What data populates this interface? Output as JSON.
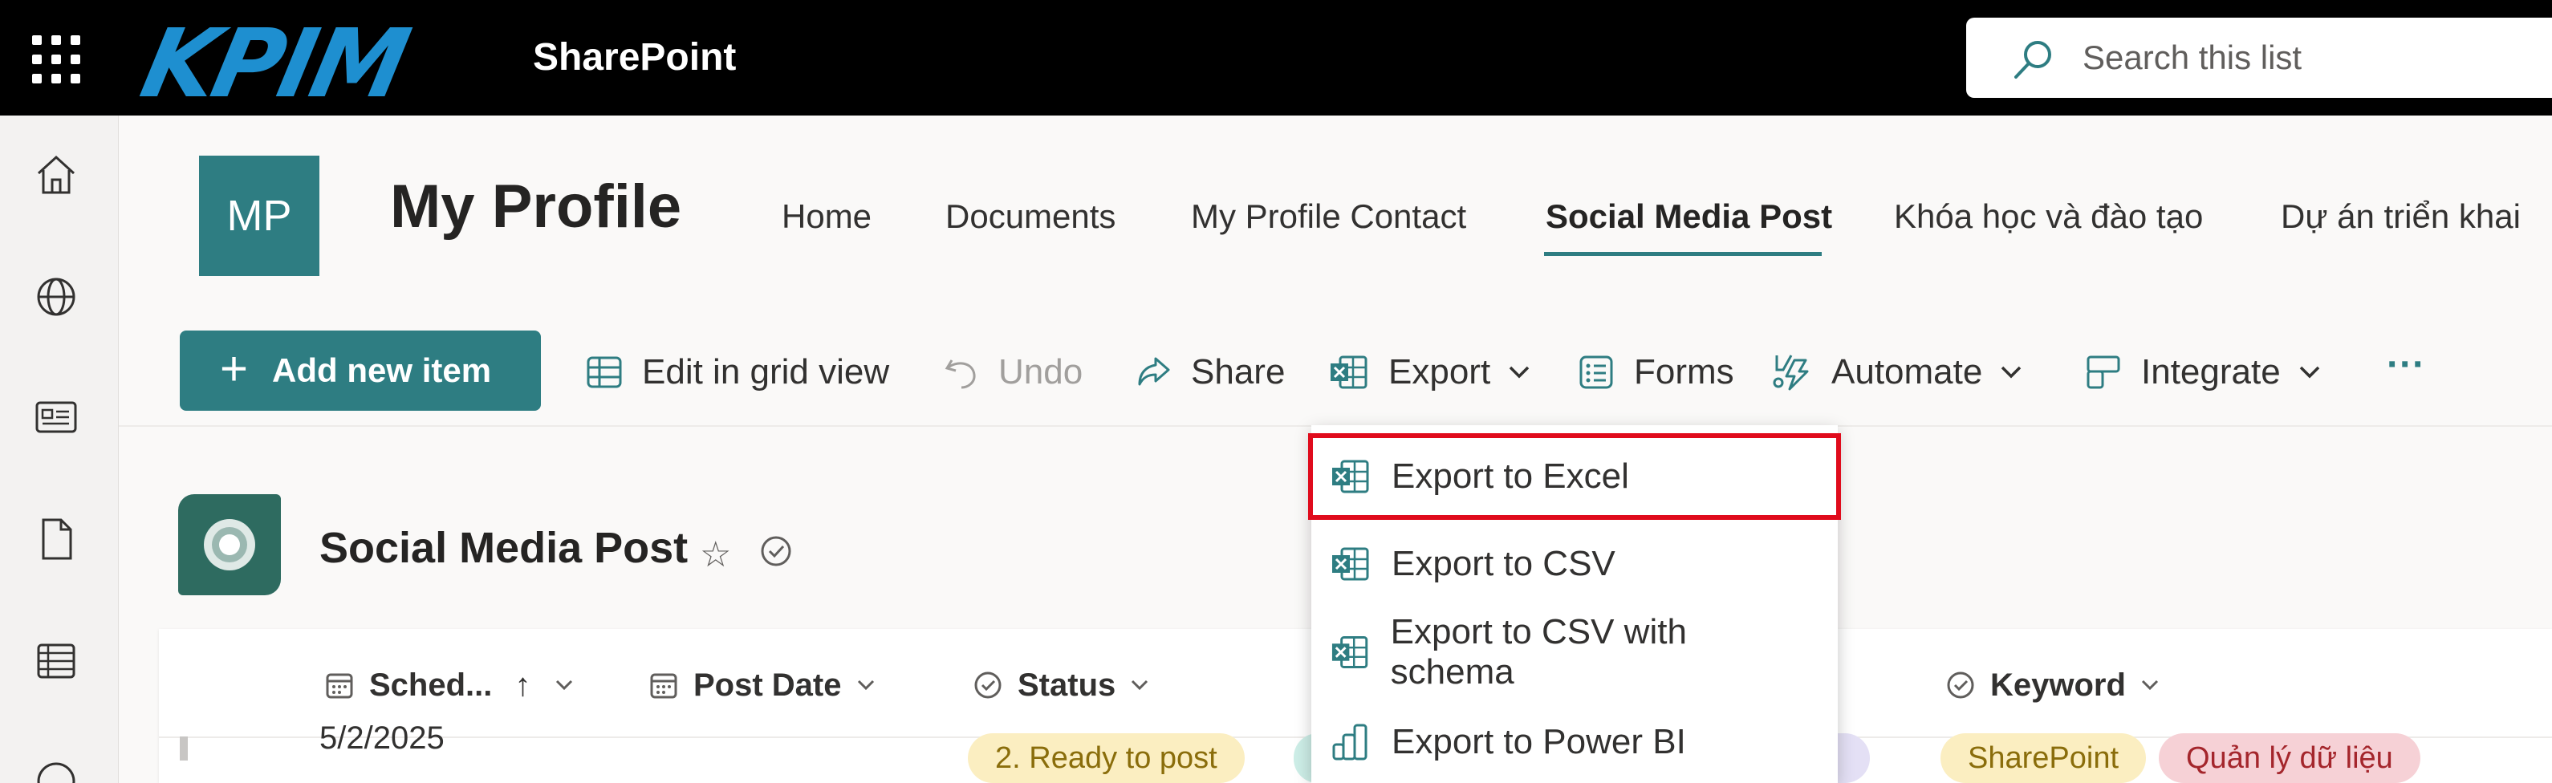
{
  "header": {
    "app_name": "SharePoint",
    "logo_text": "KPIM",
    "search_placeholder": "Search this list"
  },
  "site": {
    "logo_initials": "MP",
    "title": "My Profile",
    "nav": [
      "Home",
      "Documents",
      "My Profile Contact",
      "Social Media Post",
      "Khóa học và đào tạo",
      "Dự án triển khai"
    ],
    "active_nav": "Social Media Post"
  },
  "commands": {
    "add_new_item": "Add new item",
    "edit_grid": "Edit in grid view",
    "undo": "Undo",
    "share": "Share",
    "export": "Export",
    "forms": "Forms",
    "automate": "Automate",
    "integrate": "Integrate",
    "more": "···"
  },
  "export_menu": {
    "items": [
      "Export to Excel",
      "Export to CSV",
      "Export to CSV with schema",
      "Export to Power BI"
    ],
    "highlighted": "Export to Excel"
  },
  "list": {
    "title": "Social Media Post",
    "columns": [
      "Sched...",
      "Post Date",
      "Status",
      "Keyword"
    ],
    "row": {
      "schedule": "5/2/2025",
      "status": "2. Ready to post",
      "keywords": [
        "SharePoint",
        "Quản lý dữ liệu"
      ]
    }
  },
  "colors": {
    "accent": "#2e7d82",
    "highlight_border": "#e00b1c",
    "status_pill": "#fbeec1",
    "keyword_pill_1": "#fbeec1",
    "keyword_pill_2": "#f6d1d6"
  }
}
